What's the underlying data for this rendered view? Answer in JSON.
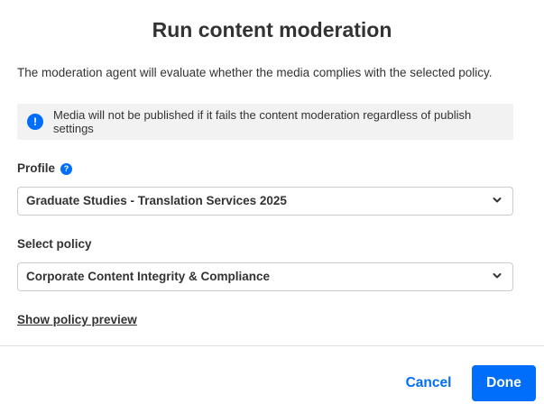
{
  "dialog": {
    "title": "Run content moderation",
    "description": "The moderation agent will evaluate whether the media complies with the selected policy.",
    "notice": {
      "icon": "info-icon",
      "icon_glyph": "!",
      "text": "Media will not be published if it fails the content moderation regardless of publish settings"
    },
    "profile": {
      "label": "Profile",
      "help_icon": "help-icon",
      "help_glyph": "?",
      "value": "Graduate Studies - Translation Services 2025"
    },
    "policy": {
      "label": "Select policy",
      "value": "Corporate Content Integrity & Compliance"
    },
    "preview_link": "Show policy preview",
    "buttons": {
      "cancel": "Cancel",
      "done": "Done"
    }
  },
  "colors": {
    "accent": "#006efa",
    "text": "#333333",
    "notice_bg": "#f2f2f2",
    "border": "#cccccc"
  }
}
